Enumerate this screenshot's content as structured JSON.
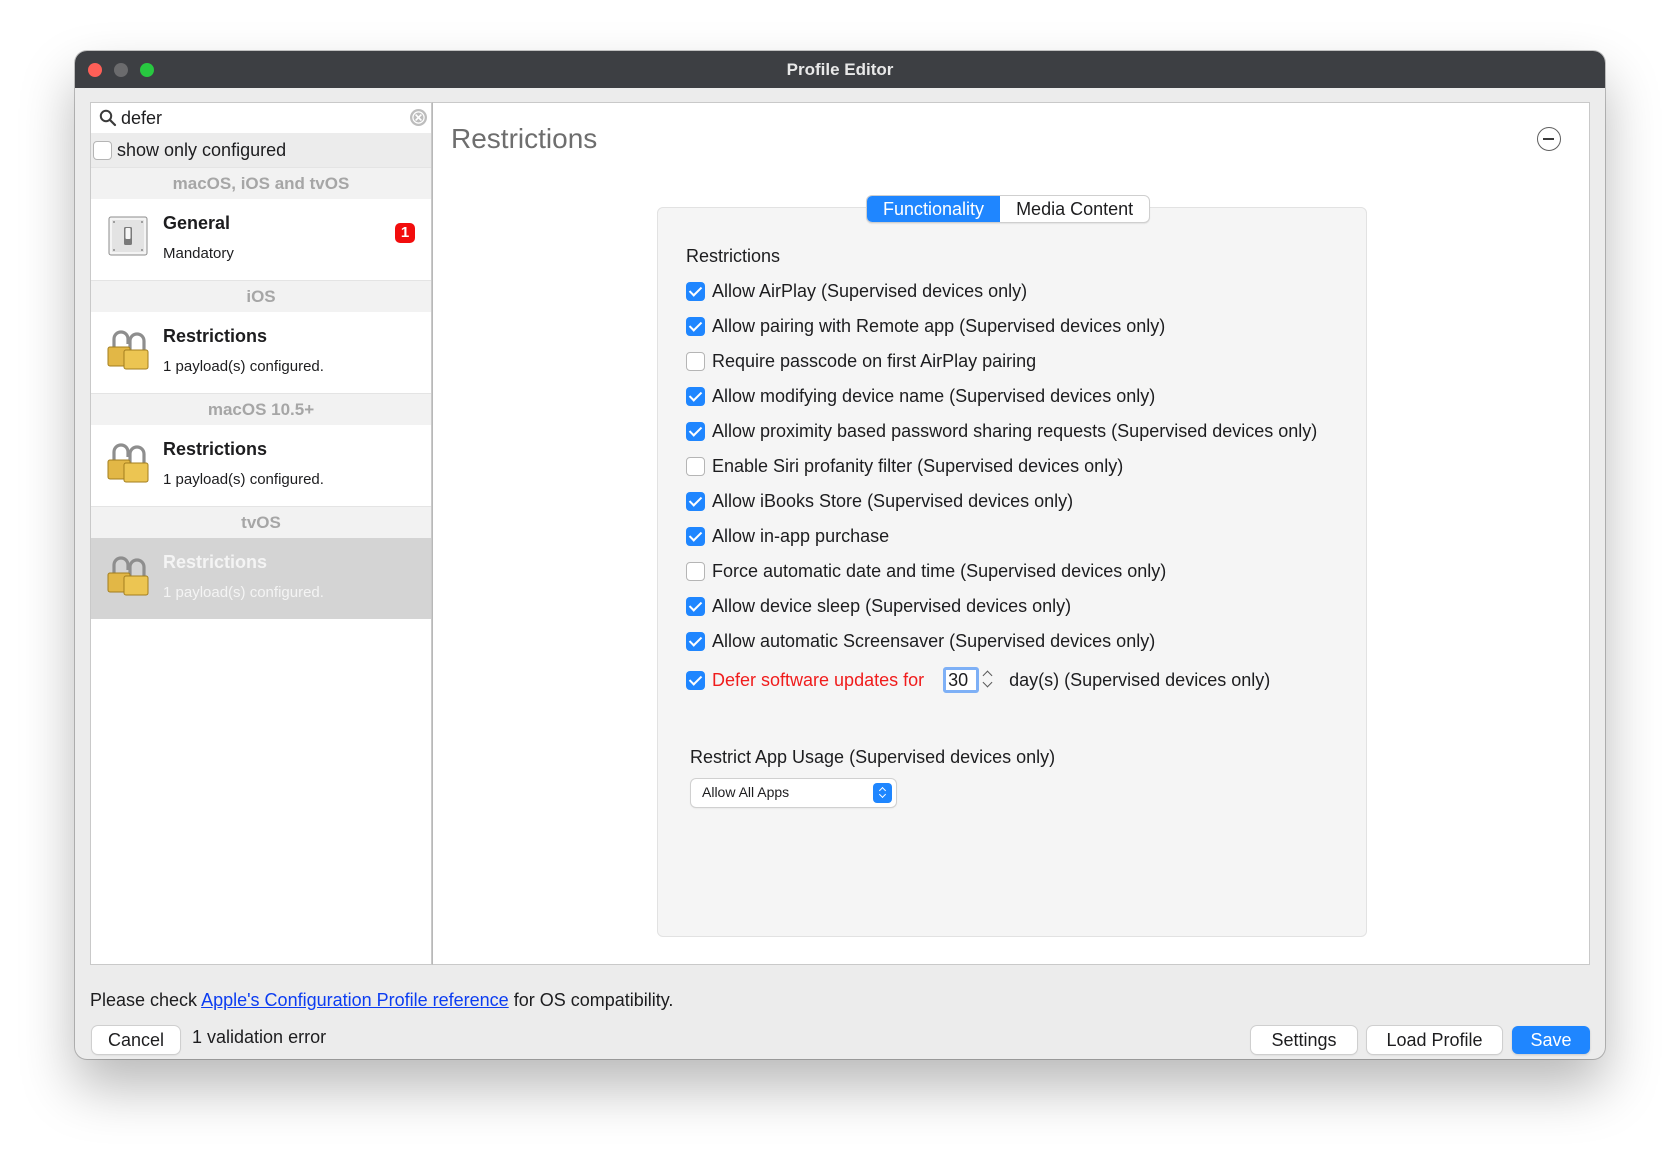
{
  "window": {
    "title": "Profile Editor"
  },
  "sidebar": {
    "search": {
      "value": "defer",
      "placeholder": ""
    },
    "show_only_configured": {
      "label": "show only configured",
      "checked": false
    },
    "sections": [
      {
        "header": "macOS, iOS and tvOS",
        "items": [
          {
            "name": "General",
            "subtitle": "Mandatory",
            "badge": "1",
            "icon": "switch-icon",
            "selected": false
          }
        ]
      },
      {
        "header": "iOS",
        "items": [
          {
            "name": "Restrictions",
            "subtitle": "1 payload(s) configured.",
            "icon": "padlock-icon",
            "selected": false
          }
        ]
      },
      {
        "header": "macOS 10.5+",
        "items": [
          {
            "name": "Restrictions",
            "subtitle": "1 payload(s) configured.",
            "icon": "padlock-icon",
            "selected": false
          }
        ]
      },
      {
        "header": "tvOS",
        "items": [
          {
            "name": "Restrictions",
            "subtitle": "1 payload(s) configured.",
            "icon": "padlock-icon",
            "selected": true
          }
        ]
      }
    ]
  },
  "main": {
    "title": "Restrictions",
    "tabs": [
      {
        "label": "Functionality",
        "active": true
      },
      {
        "label": "Media Content",
        "active": false
      }
    ],
    "group_label": "Restrictions",
    "options": [
      {
        "label": "Allow AirPlay (Supervised devices only)",
        "checked": true
      },
      {
        "label": "Allow pairing with Remote app (Supervised devices only)",
        "checked": true
      },
      {
        "label": "Require passcode on first AirPlay pairing",
        "checked": false
      },
      {
        "label": "Allow modifying device name (Supervised devices only)",
        "checked": true
      },
      {
        "label": "Allow proximity based password sharing requests (Supervised devices only)",
        "checked": true
      },
      {
        "label": "Enable Siri profanity filter (Supervised devices only)",
        "checked": false
      },
      {
        "label": "Allow iBooks Store (Supervised devices only)",
        "checked": true
      },
      {
        "label": "Allow in-app purchase",
        "checked": true
      },
      {
        "label": "Force automatic date and time (Supervised devices only)",
        "checked": false
      },
      {
        "label": "Allow device sleep (Supervised devices only)",
        "checked": true
      },
      {
        "label": "Allow automatic Screensaver (Supervised devices only)",
        "checked": true
      }
    ],
    "defer": {
      "label": "Defer software updates for",
      "value": "30",
      "suffix": "day(s) (Supervised devices only)",
      "checked": true
    },
    "app_usage": {
      "label": "Restrict App Usage (Supervised devices only)",
      "selected": "Allow All Apps"
    }
  },
  "footer": {
    "note_prefix": "Please check ",
    "note_link": "Apple's Configuration Profile reference",
    "note_suffix": " for OS compatibility.",
    "cancel": "Cancel",
    "validation": "1 validation error",
    "settings": "Settings",
    "load_profile": "Load Profile",
    "save": "Save"
  },
  "colors": {
    "accent": "#1f86ff",
    "error": "#f01c1c",
    "link": "#0b3cf1",
    "badge": "#f20d0d"
  }
}
